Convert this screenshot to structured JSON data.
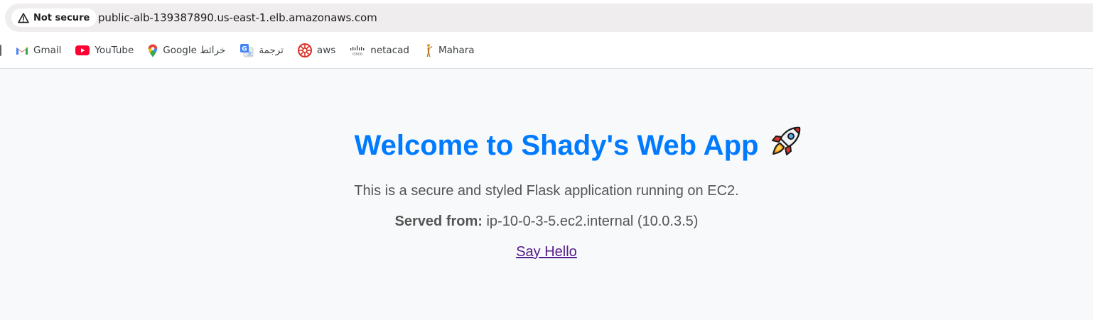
{
  "browser": {
    "security_chip": {
      "label": "Not secure",
      "icon": "warning-triangle-icon"
    },
    "url": "public-alb-139387890.us-east-1.elb.amazonaws.com"
  },
  "bookmarks": [
    {
      "label": "Gmail",
      "icon": "gmail-icon"
    },
    {
      "label": "YouTube",
      "icon": "youtube-icon"
    },
    {
      "label": "Google خرائط",
      "icon": "google-maps-icon"
    },
    {
      "label": "ترجمة",
      "icon": "google-translate-icon"
    },
    {
      "label": "aws",
      "icon": "aws-icon"
    },
    {
      "label": "netacad",
      "icon": "cisco-icon"
    },
    {
      "label": "Mahara",
      "icon": "mahara-icon"
    }
  ],
  "page": {
    "title": "Welcome to Shady's Web App",
    "title_emoji": "rocket-icon",
    "description": "This is a secure and styled Flask application running on EC2.",
    "served_label": "Served from:",
    "served_value": "ip-10-0-3-5.ec2.internal (10.0.3.5)",
    "link_label": "Say Hello"
  },
  "colors": {
    "title": "#007bff",
    "text": "#555555",
    "link_visited": "#551a8b",
    "page_background": "#f8f9fa"
  }
}
